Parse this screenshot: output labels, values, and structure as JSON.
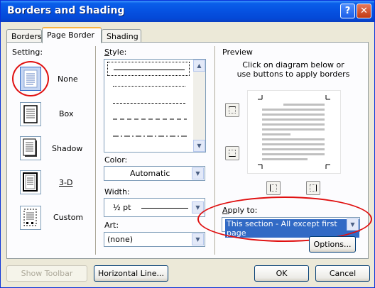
{
  "window": {
    "title": "Borders and Shading"
  },
  "titlebar": {
    "help": "?",
    "close": "✕"
  },
  "tabs": [
    {
      "label": "Borders"
    },
    {
      "label": "Page Border"
    },
    {
      "label": "Shading"
    }
  ],
  "setting": {
    "label": "Setting:",
    "options": [
      {
        "label": "None",
        "selected": true
      },
      {
        "label": "Box"
      },
      {
        "label": "Shadow"
      },
      {
        "label": "3-D"
      },
      {
        "label": "Custom"
      }
    ]
  },
  "style": {
    "label": "Style:",
    "lines": [
      "solid",
      "dotted",
      "dashed-small",
      "dashed",
      "dash-dot"
    ]
  },
  "color": {
    "label": "Color:",
    "value": "Automatic"
  },
  "width": {
    "label": "Width:",
    "value": "½ pt"
  },
  "art": {
    "label": "Art:",
    "value": "(none)"
  },
  "preview": {
    "label": "Preview",
    "instructions": "Click on diagram below or use buttons to apply borders"
  },
  "apply_to": {
    "label": "Apply to:",
    "value": "This section - All except first page"
  },
  "buttons": {
    "options": "Options...",
    "show_toolbar": "Show Toolbar",
    "horizontal_line": "Horizontal Line...",
    "ok": "OK",
    "cancel": "Cancel"
  },
  "colors": {
    "titlebar": "#0653e2",
    "highlight": "#316ac5",
    "annotation": "#e01010"
  }
}
